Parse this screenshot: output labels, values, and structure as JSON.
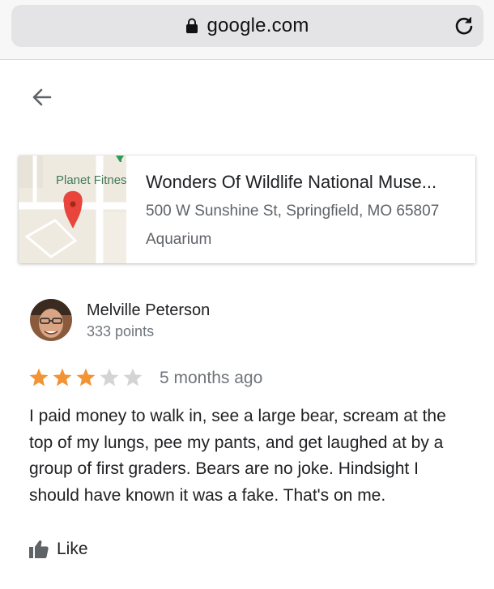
{
  "browser": {
    "url": "google.com",
    "icons": {
      "lock": "lock-icon",
      "reload": "reload-icon"
    }
  },
  "nav": {
    "back_icon": "back-arrow-icon"
  },
  "place": {
    "name": "Wonders Of Wildlife National Muse...",
    "address": "500 W Sunshine St, Springfield, MO 65807",
    "category": "Aquarium",
    "map_label": "Planet Fitness",
    "pin_color": "#e8453c"
  },
  "review": {
    "author": "Melville Peterson",
    "points": "333 points",
    "rating": 3,
    "max_rating": 5,
    "time": "5 months ago",
    "text": "I paid money to walk in, see a large bear, scream at the top of my lungs, pee my pants, and get laughed at by a group of first graders. Bears are no joke. Hindsight I should have known it was a fake. That's on me.",
    "star_color_filled": "#f29336",
    "star_color_empty": "#d4d4d4"
  },
  "actions": {
    "like_label": "Like",
    "like_icon": "thumbs-up-icon"
  }
}
